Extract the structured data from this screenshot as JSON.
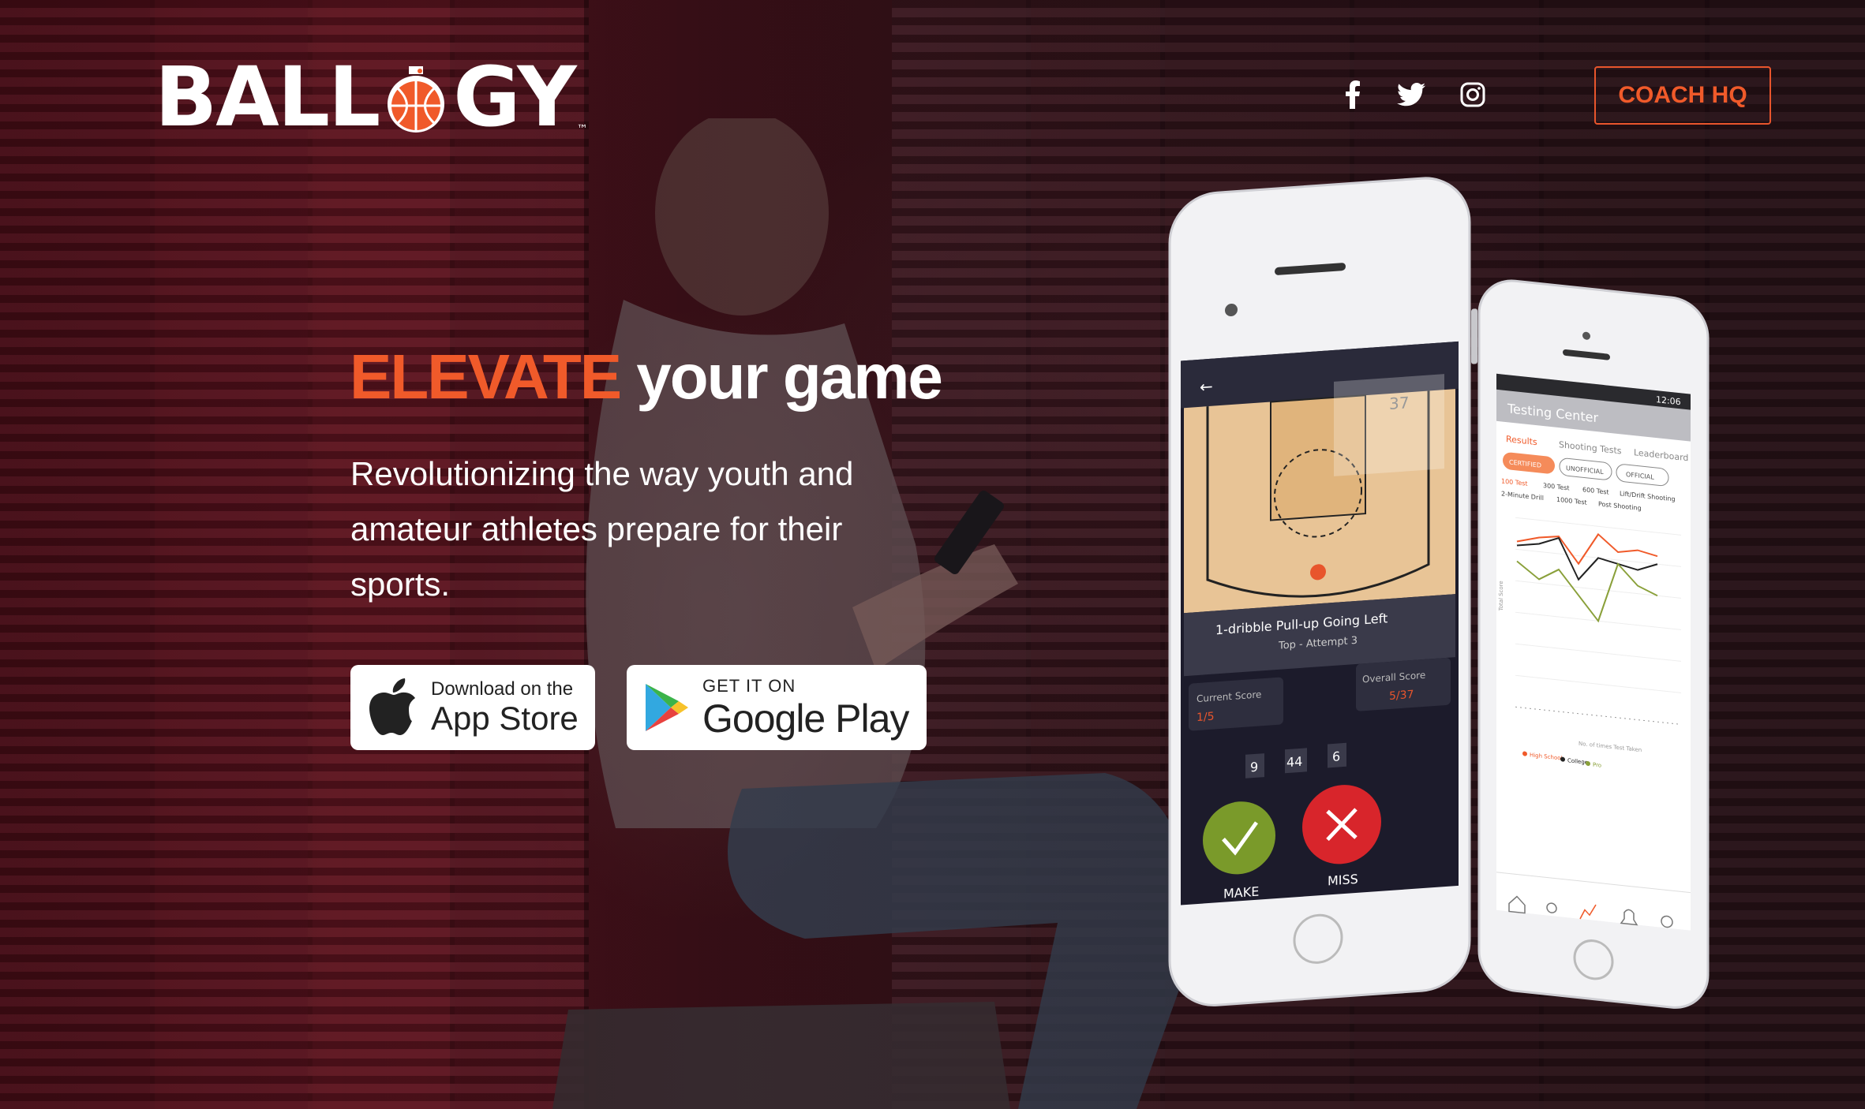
{
  "brand": {
    "name_part1": "BALL",
    "name_part2": "GY",
    "trademark": "™",
    "accent_color": "#f05a2a"
  },
  "header": {
    "social": [
      "facebook-icon",
      "twitter-icon",
      "instagram-icon"
    ],
    "coach_label": "COACH HQ"
  },
  "hero": {
    "headline_accent": "ELEVATE",
    "headline_rest": " your game",
    "subtext": "Revolutionizing the way youth and amateur athletes prepare for their sports."
  },
  "stores": {
    "apple_small": "Download on the",
    "apple_big": "App Store",
    "google_small": "GET IT ON",
    "google_big": "Google Play"
  },
  "phone1": {
    "attempt_no": "37",
    "drill_title": "1-dribble Pull-up Going Left",
    "drill_sub": "Top - Attempt 3",
    "current_score_label": "Current Score",
    "current_score": "1/5",
    "overall_score_label": "Overall Score",
    "overall_score": "5/37",
    "timer": [
      "9",
      "44",
      "6"
    ],
    "make_label": "MAKE",
    "miss_label": "MISS"
  },
  "phone2": {
    "clock": "12:06",
    "screen_title": "Testing Center",
    "tabs": [
      "Results",
      "Shooting Tests",
      "Leaderboard"
    ],
    "filters": [
      "CERTIFIED",
      "UNOFFICIAL",
      "OFFICIAL"
    ],
    "tests_row1": [
      "100 Test",
      "300 Test",
      "600 Test",
      "Lift/Drift Shooting"
    ],
    "tests_row2": [
      "2-Minute Drill",
      "1000 Test",
      "Post Shooting"
    ],
    "y_axis_label": "Total Score",
    "x_axis_label": "No. of times Test Taken",
    "legend": [
      "High School",
      "College",
      "Pro"
    ]
  }
}
